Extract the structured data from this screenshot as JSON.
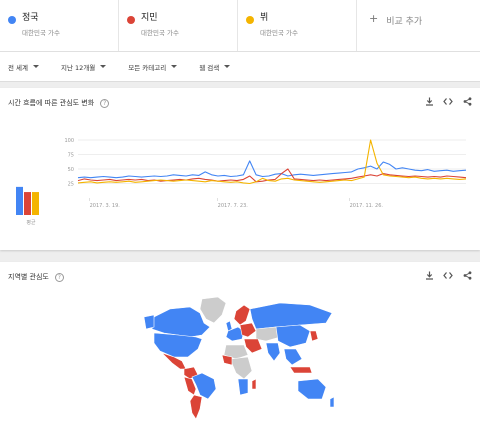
{
  "terms": [
    {
      "name": "정국",
      "sub": "대한민국 가수",
      "color": "#4285f4"
    },
    {
      "name": "지민",
      "sub": "대한민국 가수",
      "color": "#db4437"
    },
    {
      "name": "뷔",
      "sub": "대한민국 가수",
      "color": "#f4b400"
    }
  ],
  "add_term": {
    "icon": "plus-icon",
    "label": "비교 추가"
  },
  "filters": [
    {
      "label": "전 세계"
    },
    {
      "label": "지난 12개월"
    },
    {
      "label": "모든 카테고리"
    },
    {
      "label": "웹 검색"
    }
  ],
  "interest_card": {
    "title": "시간 흐름에 따른 관심도 변화",
    "avg_label": "평균",
    "actions": [
      "download-icon",
      "embed-icon",
      "share-icon"
    ]
  },
  "region_card": {
    "title": "지역별 관심도",
    "actions": [
      "download-icon",
      "embed-icon",
      "share-icon"
    ]
  },
  "chart_data": {
    "type": "line",
    "y_ticks": [
      100,
      75,
      50,
      25
    ],
    "ylim": [
      0,
      100
    ],
    "x_tick_labels": [
      "2017. 3. 19.",
      "2017. 7. 23.",
      "2017. 11. 26."
    ],
    "averages": [
      {
        "name": "정국",
        "value": 38
      },
      {
        "name": "지민",
        "value": 31
      },
      {
        "name": "뷔",
        "value": 31
      }
    ],
    "series": [
      {
        "name": "정국",
        "color": "#4285f4",
        "values": [
          35,
          36,
          35,
          36,
          37,
          36,
          35,
          36,
          38,
          37,
          36,
          37,
          38,
          37,
          38,
          40,
          39,
          38,
          40,
          39,
          45,
          40,
          38,
          39,
          37,
          38,
          40,
          64,
          40,
          37,
          38,
          41,
          42,
          38,
          40,
          41,
          40,
          39,
          40,
          41,
          42,
          43,
          44,
          45,
          50,
          52,
          55,
          50,
          62,
          58,
          50,
          52,
          50,
          48,
          47,
          49,
          46,
          47,
          48,
          46,
          47,
          48
        ]
      },
      {
        "name": "지민",
        "color": "#db4437",
        "values": [
          30,
          33,
          31,
          30,
          31,
          32,
          30,
          31,
          32,
          31,
          32,
          30,
          31,
          29,
          30,
          31,
          32,
          31,
          33,
          34,
          32,
          31,
          29,
          30,
          31,
          30,
          32,
          38,
          28,
          29,
          31,
          32,
          42,
          50,
          33,
          32,
          31,
          30,
          31,
          30,
          31,
          32,
          33,
          34,
          36,
          38,
          40,
          38,
          42,
          40,
          39,
          38,
          37,
          38,
          37,
          36,
          37,
          36,
          38,
          37,
          36,
          35
        ]
      },
      {
        "name": "뷔",
        "color": "#f4b400",
        "values": [
          26,
          27,
          28,
          26,
          27,
          28,
          27,
          28,
          29,
          27,
          28,
          29,
          30,
          31,
          30,
          29,
          30,
          31,
          30,
          29,
          28,
          30,
          29,
          28,
          27,
          28,
          26,
          25,
          28,
          34,
          30,
          29,
          33,
          34,
          31,
          30,
          29,
          28,
          27,
          28,
          29,
          30,
          31,
          30,
          33,
          36,
          100,
          60,
          40,
          38,
          37,
          36,
          35,
          36,
          34,
          33,
          34,
          33,
          34,
          33,
          32,
          33
        ]
      }
    ]
  },
  "map_colors": {
    "blue": "#4285f4",
    "red": "#db4437",
    "gray": "#cccccc"
  }
}
